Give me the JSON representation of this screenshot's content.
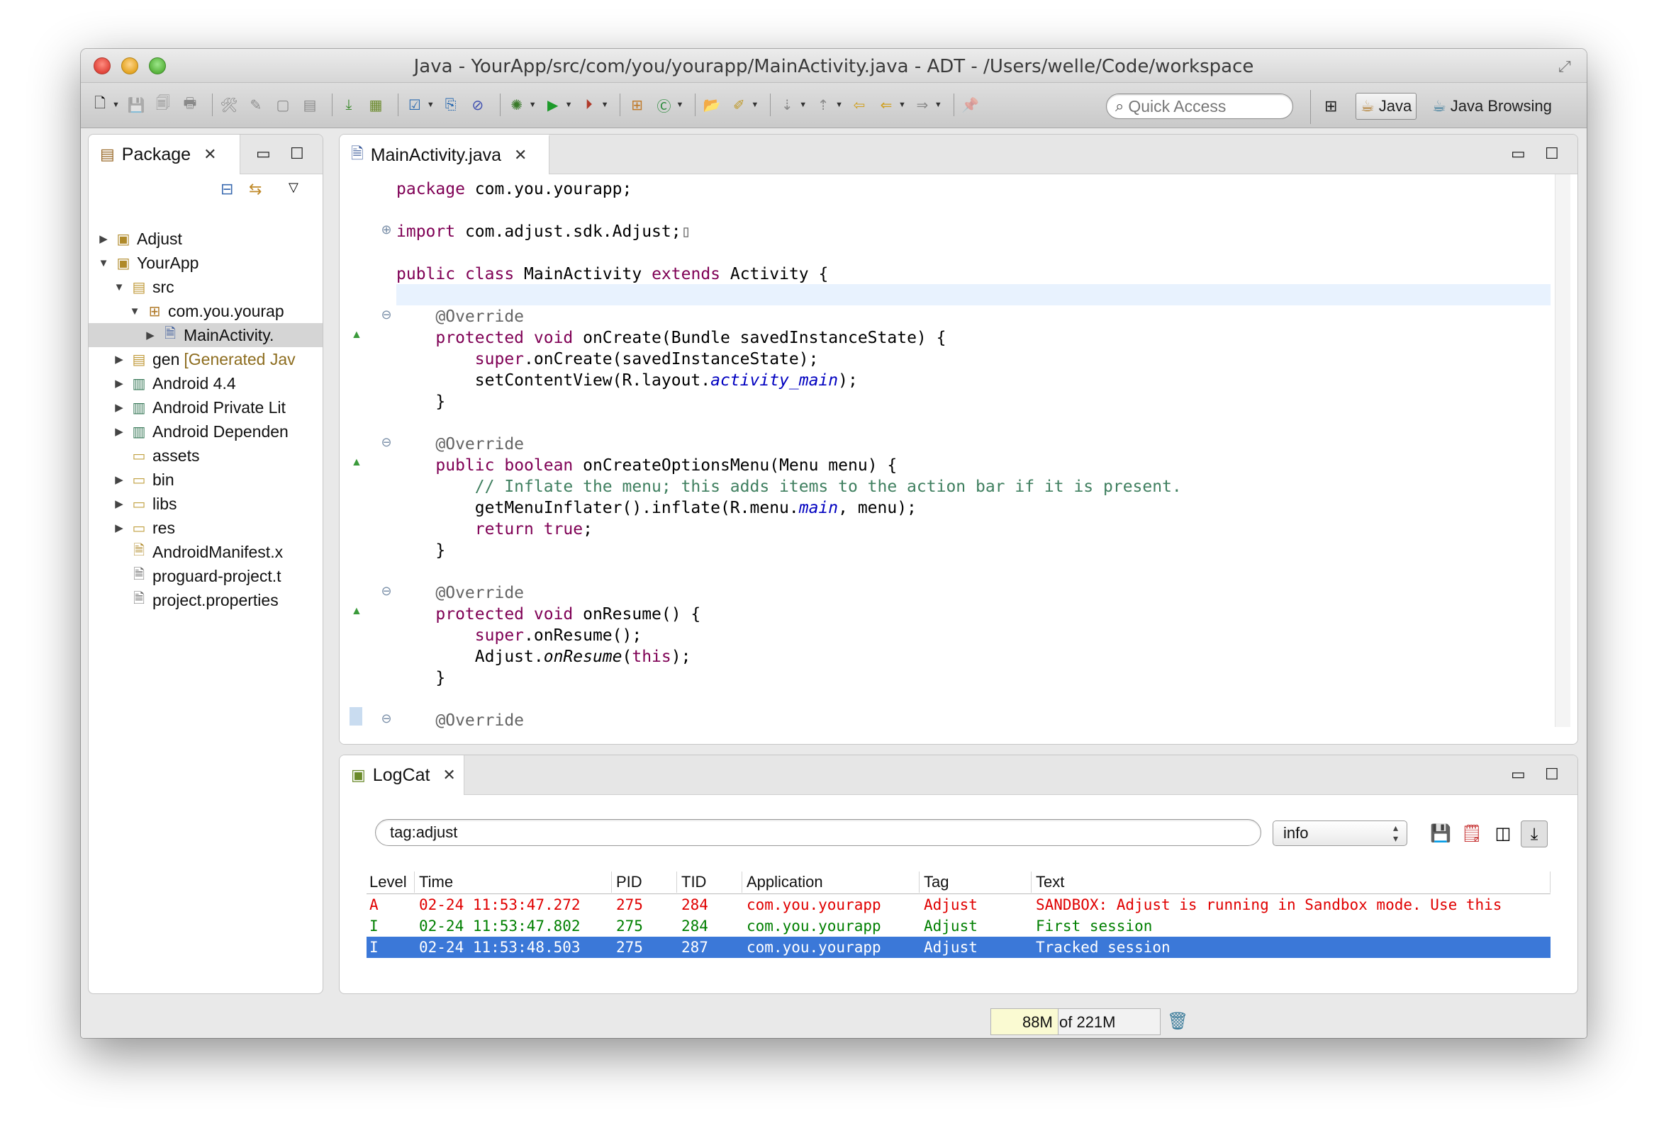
{
  "window": {
    "title": "Java - YourApp/src/com/you/yourapp/MainActivity.java - ADT - /Users/welle/Code/workspace"
  },
  "toolbar": {
    "quick_access_placeholder": "Quick Access",
    "perspectives": [
      {
        "label": "Java",
        "active": true
      },
      {
        "label": "Java Browsing",
        "active": false
      }
    ]
  },
  "package_explorer": {
    "tab_label": "Package",
    "tree": [
      {
        "label": "Adjust",
        "indent": 0,
        "expanded": false,
        "has_arrow": true,
        "icon": "project-icon"
      },
      {
        "label": "YourApp",
        "indent": 0,
        "expanded": true,
        "has_arrow": true,
        "icon": "project-icon"
      },
      {
        "label": "src",
        "indent": 1,
        "expanded": true,
        "has_arrow": true,
        "icon": "source-folder-icon"
      },
      {
        "label": "com.you.yourap",
        "indent": 2,
        "expanded": true,
        "has_arrow": true,
        "icon": "package-icon"
      },
      {
        "label": "MainActivity.",
        "indent": 3,
        "expanded": false,
        "has_arrow": true,
        "icon": "java-file-icon",
        "selected": true
      },
      {
        "label": "gen",
        "decor": "[Generated Jav",
        "indent": 1,
        "expanded": false,
        "has_arrow": true,
        "icon": "source-folder-icon"
      },
      {
        "label": "Android 4.4",
        "indent": 1,
        "expanded": false,
        "has_arrow": true,
        "icon": "library-icon"
      },
      {
        "label": "Android Private Lit",
        "indent": 1,
        "expanded": false,
        "has_arrow": true,
        "icon": "library-icon"
      },
      {
        "label": "Android Dependen",
        "indent": 1,
        "expanded": false,
        "has_arrow": true,
        "icon": "library-icon"
      },
      {
        "label": "assets",
        "indent": 1,
        "expanded": false,
        "has_arrow": false,
        "icon": "folder-icon"
      },
      {
        "label": "bin",
        "indent": 1,
        "expanded": false,
        "has_arrow": true,
        "icon": "folder-icon"
      },
      {
        "label": "libs",
        "indent": 1,
        "expanded": false,
        "has_arrow": true,
        "icon": "folder-icon"
      },
      {
        "label": "res",
        "indent": 1,
        "expanded": false,
        "has_arrow": true,
        "icon": "folder-icon"
      },
      {
        "label": "AndroidManifest.x",
        "indent": 1,
        "expanded": false,
        "has_arrow": false,
        "icon": "manifest-file-icon"
      },
      {
        "label": "proguard-project.t",
        "indent": 1,
        "expanded": false,
        "has_arrow": false,
        "icon": "text-file-icon"
      },
      {
        "label": "project.properties",
        "indent": 1,
        "expanded": false,
        "has_arrow": false,
        "icon": "text-file-icon"
      }
    ]
  },
  "editor": {
    "tab_label": "MainActivity.java",
    "lines": [
      {
        "row": 0,
        "segments": [
          {
            "t": "package",
            "c": "kw"
          },
          {
            "t": " com.you.yourapp;"
          }
        ]
      },
      {
        "row": 2,
        "fold": "plus",
        "segments": [
          {
            "t": "import",
            "c": "kw"
          },
          {
            "t": " com.adjust.sdk.Adjust;"
          },
          {
            "t": "▯",
            "c": "ann"
          }
        ]
      },
      {
        "row": 4,
        "segments": [
          {
            "t": "public",
            "c": "kw"
          },
          {
            "t": " "
          },
          {
            "t": "class",
            "c": "kw"
          },
          {
            "t": " MainActivity "
          },
          {
            "t": "extends",
            "c": "kw"
          },
          {
            "t": " Activity {"
          }
        ]
      },
      {
        "row": 6,
        "fold": "minus",
        "segments": [
          {
            "t": "    "
          },
          {
            "t": "@Override",
            "c": "ann"
          }
        ]
      },
      {
        "row": 7,
        "override": true,
        "segments": [
          {
            "t": "    "
          },
          {
            "t": "protected",
            "c": "kw"
          },
          {
            "t": " "
          },
          {
            "t": "void",
            "c": "kw"
          },
          {
            "t": " onCreate(Bundle savedInstanceState) {"
          }
        ]
      },
      {
        "row": 8,
        "segments": [
          {
            "t": "        "
          },
          {
            "t": "super",
            "c": "kw"
          },
          {
            "t": ".onCreate(savedInstanceState);"
          }
        ]
      },
      {
        "row": 9,
        "segments": [
          {
            "t": "        setContentView(R.layout."
          },
          {
            "t": "activity_main",
            "c": "fld"
          },
          {
            "t": ");"
          }
        ]
      },
      {
        "row": 10,
        "segments": [
          {
            "t": "    }"
          }
        ]
      },
      {
        "row": 12,
        "fold": "minus",
        "segments": [
          {
            "t": "    "
          },
          {
            "t": "@Override",
            "c": "ann"
          }
        ]
      },
      {
        "row": 13,
        "override": true,
        "segments": [
          {
            "t": "    "
          },
          {
            "t": "public",
            "c": "kw"
          },
          {
            "t": " "
          },
          {
            "t": "boolean",
            "c": "kw"
          },
          {
            "t": " onCreateOptionsMenu(Menu menu) {"
          }
        ]
      },
      {
        "row": 14,
        "segments": [
          {
            "t": "        "
          },
          {
            "t": "// Inflate the menu; this adds items to the action bar if it is present.",
            "c": "com"
          }
        ]
      },
      {
        "row": 15,
        "segments": [
          {
            "t": "        getMenuInflater().inflate(R.menu."
          },
          {
            "t": "main",
            "c": "fld"
          },
          {
            "t": ", menu);"
          }
        ]
      },
      {
        "row": 16,
        "segments": [
          {
            "t": "        "
          },
          {
            "t": "return",
            "c": "kw"
          },
          {
            "t": " "
          },
          {
            "t": "true",
            "c": "kw"
          },
          {
            "t": ";"
          }
        ]
      },
      {
        "row": 17,
        "segments": [
          {
            "t": "    }"
          }
        ]
      },
      {
        "row": 19,
        "fold": "minus",
        "segments": [
          {
            "t": "    "
          },
          {
            "t": "@Override",
            "c": "ann"
          }
        ]
      },
      {
        "row": 20,
        "override": true,
        "segments": [
          {
            "t": "    "
          },
          {
            "t": "protected",
            "c": "kw"
          },
          {
            "t": " "
          },
          {
            "t": "void",
            "c": "kw"
          },
          {
            "t": " onResume() {"
          }
        ]
      },
      {
        "row": 21,
        "segments": [
          {
            "t": "        "
          },
          {
            "t": "super",
            "c": "kw"
          },
          {
            "t": ".onResume();"
          }
        ]
      },
      {
        "row": 22,
        "segments": [
          {
            "t": "        Adjust."
          },
          {
            "t": "onResume",
            "c": "stat"
          },
          {
            "t": "("
          },
          {
            "t": "this",
            "c": "kw"
          },
          {
            "t": ");"
          }
        ]
      },
      {
        "row": 23,
        "segments": [
          {
            "t": "    }"
          }
        ]
      },
      {
        "row": 25,
        "fold": "minus",
        "segments": [
          {
            "t": "    "
          },
          {
            "t": "@Override",
            "c": "ann"
          }
        ]
      }
    ]
  },
  "logcat": {
    "tab_label": "LogCat",
    "filter_value": "tag:adjust",
    "level_selected": "info",
    "columns": [
      "Level",
      "Time",
      "PID",
      "TID",
      "Application",
      "Tag",
      "Text"
    ],
    "rows": [
      {
        "level": "A",
        "time": "02-24 11:53:47.272",
        "pid": "275",
        "tid": "284",
        "app": "com.you.yourapp",
        "tag": "Adjust",
        "text": "SANDBOX: Adjust is running in Sandbox mode. Use this",
        "color": "#e00000",
        "selected": false
      },
      {
        "level": "I",
        "time": "02-24 11:53:47.802",
        "pid": "275",
        "tid": "284",
        "app": "com.you.yourapp",
        "tag": "Adjust",
        "text": "First session",
        "color": "#007f00",
        "selected": false
      },
      {
        "level": "I",
        "time": "02-24 11:53:48.503",
        "pid": "275",
        "tid": "287",
        "app": "com.you.yourapp",
        "tag": "Adjust",
        "text": "Tracked session",
        "color": "#ffffff",
        "selected": true
      }
    ]
  },
  "status": {
    "heap_used": "88M",
    "heap_total": "of 221M",
    "heap_fraction": 0.398
  }
}
